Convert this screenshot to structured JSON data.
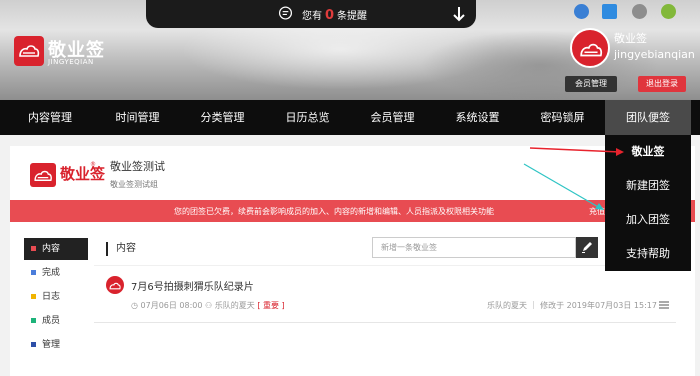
{
  "notice": {
    "prefix": "您有",
    "count": "0",
    "suffix": "条提醒"
  },
  "brand": {
    "name": "敬业签",
    "sub": "JINGYEQIAN",
    "accent": "#d9232d"
  },
  "user": {
    "label": "敬业签",
    "name": "jingyebianqian",
    "member_button": "会员管理",
    "logout_button": "退出登录"
  },
  "nav": [
    "内容管理",
    "时间管理",
    "分类管理",
    "日历总览",
    "会员管理",
    "系统设置",
    "密码锁屏",
    "团队便签"
  ],
  "dropdown": [
    "敬业签",
    "新建团签",
    "加入团签",
    "支持帮助"
  ],
  "card": {
    "logo_text": "敬业签",
    "logo_reg": "®",
    "title": "敬业签测试",
    "desc": "敬业签测试组"
  },
  "alert": {
    "text": "您的团签已欠费，续费前会影响成员的加入、内容的新增和编辑、人员指派及权限相关功能",
    "link": "充值"
  },
  "side_menu": [
    {
      "label": "内容",
      "color": "#e84c52"
    },
    {
      "label": "完成",
      "color": "#4a7ddb"
    },
    {
      "label": "日志",
      "color": "#f0b400"
    },
    {
      "label": "成员",
      "color": "#1db37a"
    },
    {
      "label": "管理",
      "color": "#2d4fa8"
    }
  ],
  "content": {
    "title": "内容",
    "search_placeholder": "新增一条敬业签"
  },
  "item": {
    "title": "7月6号拍摄刺猬乐队纪录片",
    "date": "07月06日 08:00",
    "team": "乐队的夏天",
    "tag": "[ 重要 ]",
    "right": "乐队的夏天 ｜ 修改于 2019年07月03日 15:17"
  }
}
